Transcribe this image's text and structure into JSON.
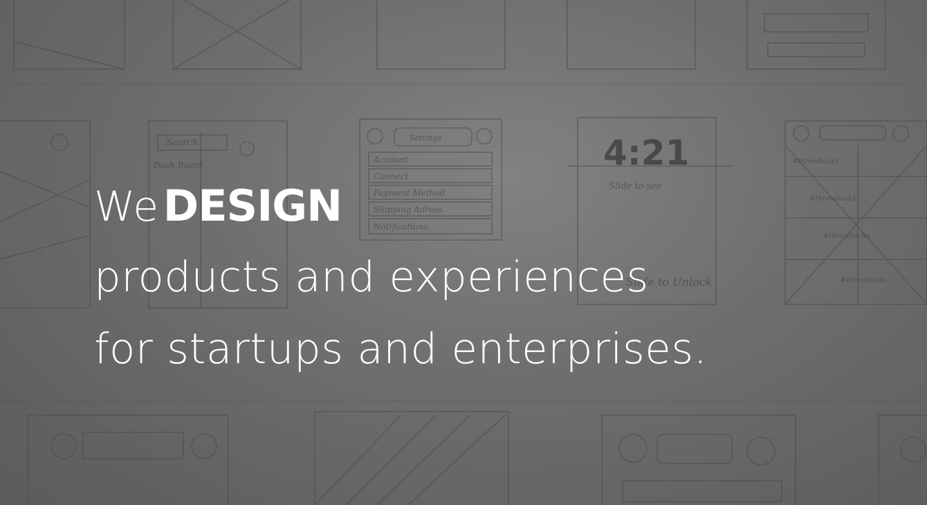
{
  "hero": {
    "word_we": "We",
    "word_design": "DESIGN",
    "line2": "products and experiences",
    "line3": "for startups and enterprises."
  },
  "sketch": {
    "settings_title": "Settings",
    "settings_items": [
      "Account",
      "Connect",
      "Payment Method",
      "Shipping Adress",
      "Notifications."
    ],
    "clock": "4:21",
    "slide_to_see": "Slide to see",
    "slide_to_unlock": "Slide to Unlock",
    "search_label": "Search",
    "dashboard_label": "Dash Board",
    "throwbacks": "#throwbacks",
    "colors": {
      "background": "#737373",
      "pencil": "#3c3c3c",
      "text": "#ffffff"
    }
  }
}
